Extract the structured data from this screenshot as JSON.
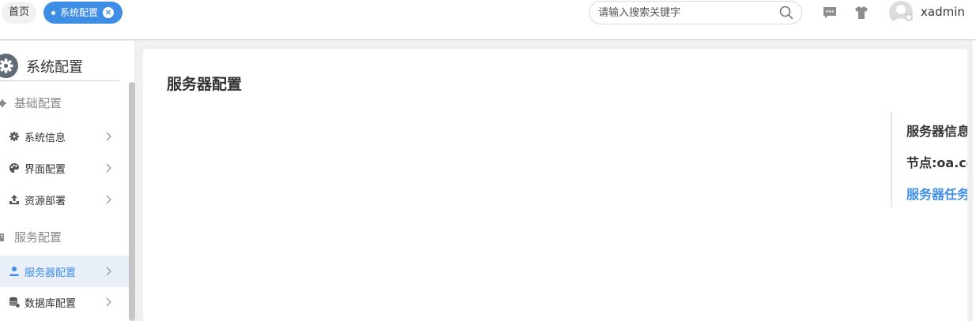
{
  "tabs": {
    "home_label": "首页",
    "active_label": "系统配置",
    "close_symbol": "×"
  },
  "search": {
    "placeholder": "请输入搜索关键字",
    "icon": "search-icon"
  },
  "header": {
    "username": "xadmin",
    "icons": [
      "chat-icon",
      "shirt-icon",
      "avatar"
    ]
  },
  "sidebar": {
    "title": "系统配置",
    "groups": [
      {
        "label": "基础配置",
        "items": [
          {
            "label": "系统信息",
            "icon": "gear-icon"
          },
          {
            "label": "界面配置",
            "icon": "palette-icon"
          },
          {
            "label": "资源部署",
            "icon": "upload-icon"
          }
        ]
      },
      {
        "label": "服务配置",
        "items": [
          {
            "label": "服务器配置",
            "icon": "user-server-icon",
            "active": true
          },
          {
            "label": "数据库配置",
            "icon": "database-icon"
          }
        ]
      }
    ]
  },
  "main": {
    "title": "服务器配置",
    "anchors": [
      {
        "label": "服务器信息"
      },
      {
        "label": "节点:oa.co"
      },
      {
        "label": "服务器任务",
        "active": true
      }
    ]
  },
  "colors": {
    "accent": "#3e8ee6",
    "active_bg": "#e9eff8",
    "muted_text": "#8a8a8a"
  }
}
